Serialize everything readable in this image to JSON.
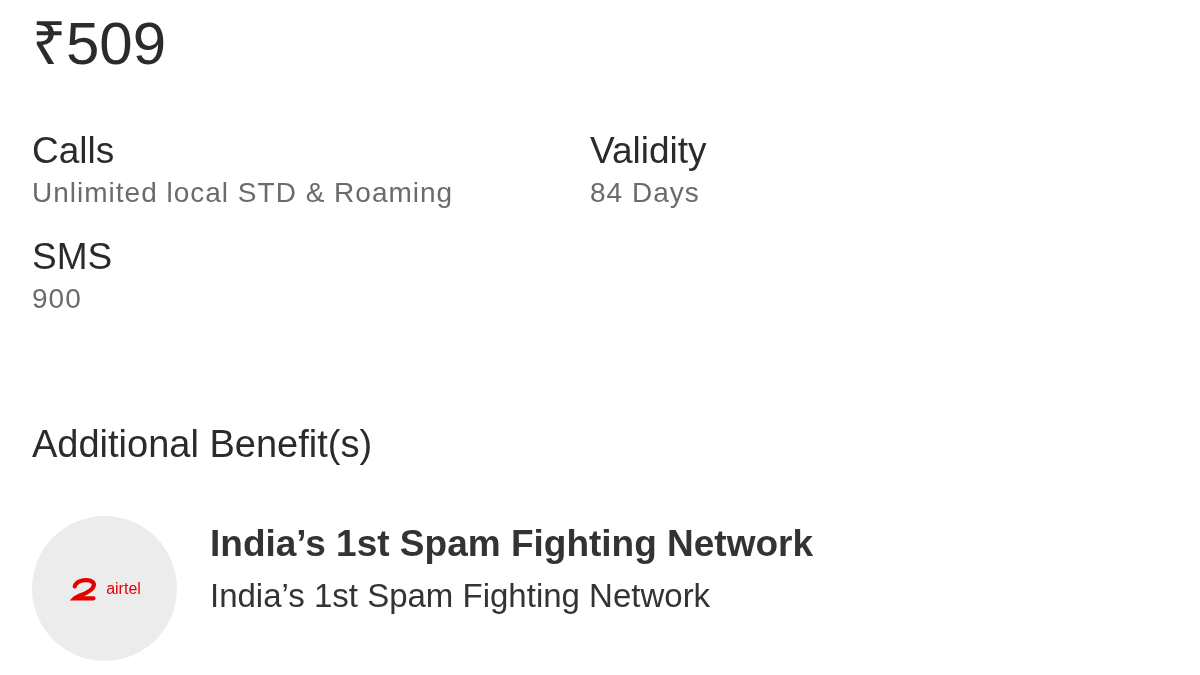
{
  "price": "₹509",
  "details": [
    {
      "label": "Calls",
      "value": "Unlimited local STD & Roaming"
    },
    {
      "label": "Validity",
      "value": "84 Days"
    },
    {
      "label": "SMS",
      "value": "900"
    }
  ],
  "benefits_heading": "Additional Benefit(s)",
  "benefits": [
    {
      "logo_text": "airtel",
      "title": "India’s 1st Spam Fighting Network",
      "subtitle": "India’s 1st Spam Fighting Network"
    }
  ]
}
